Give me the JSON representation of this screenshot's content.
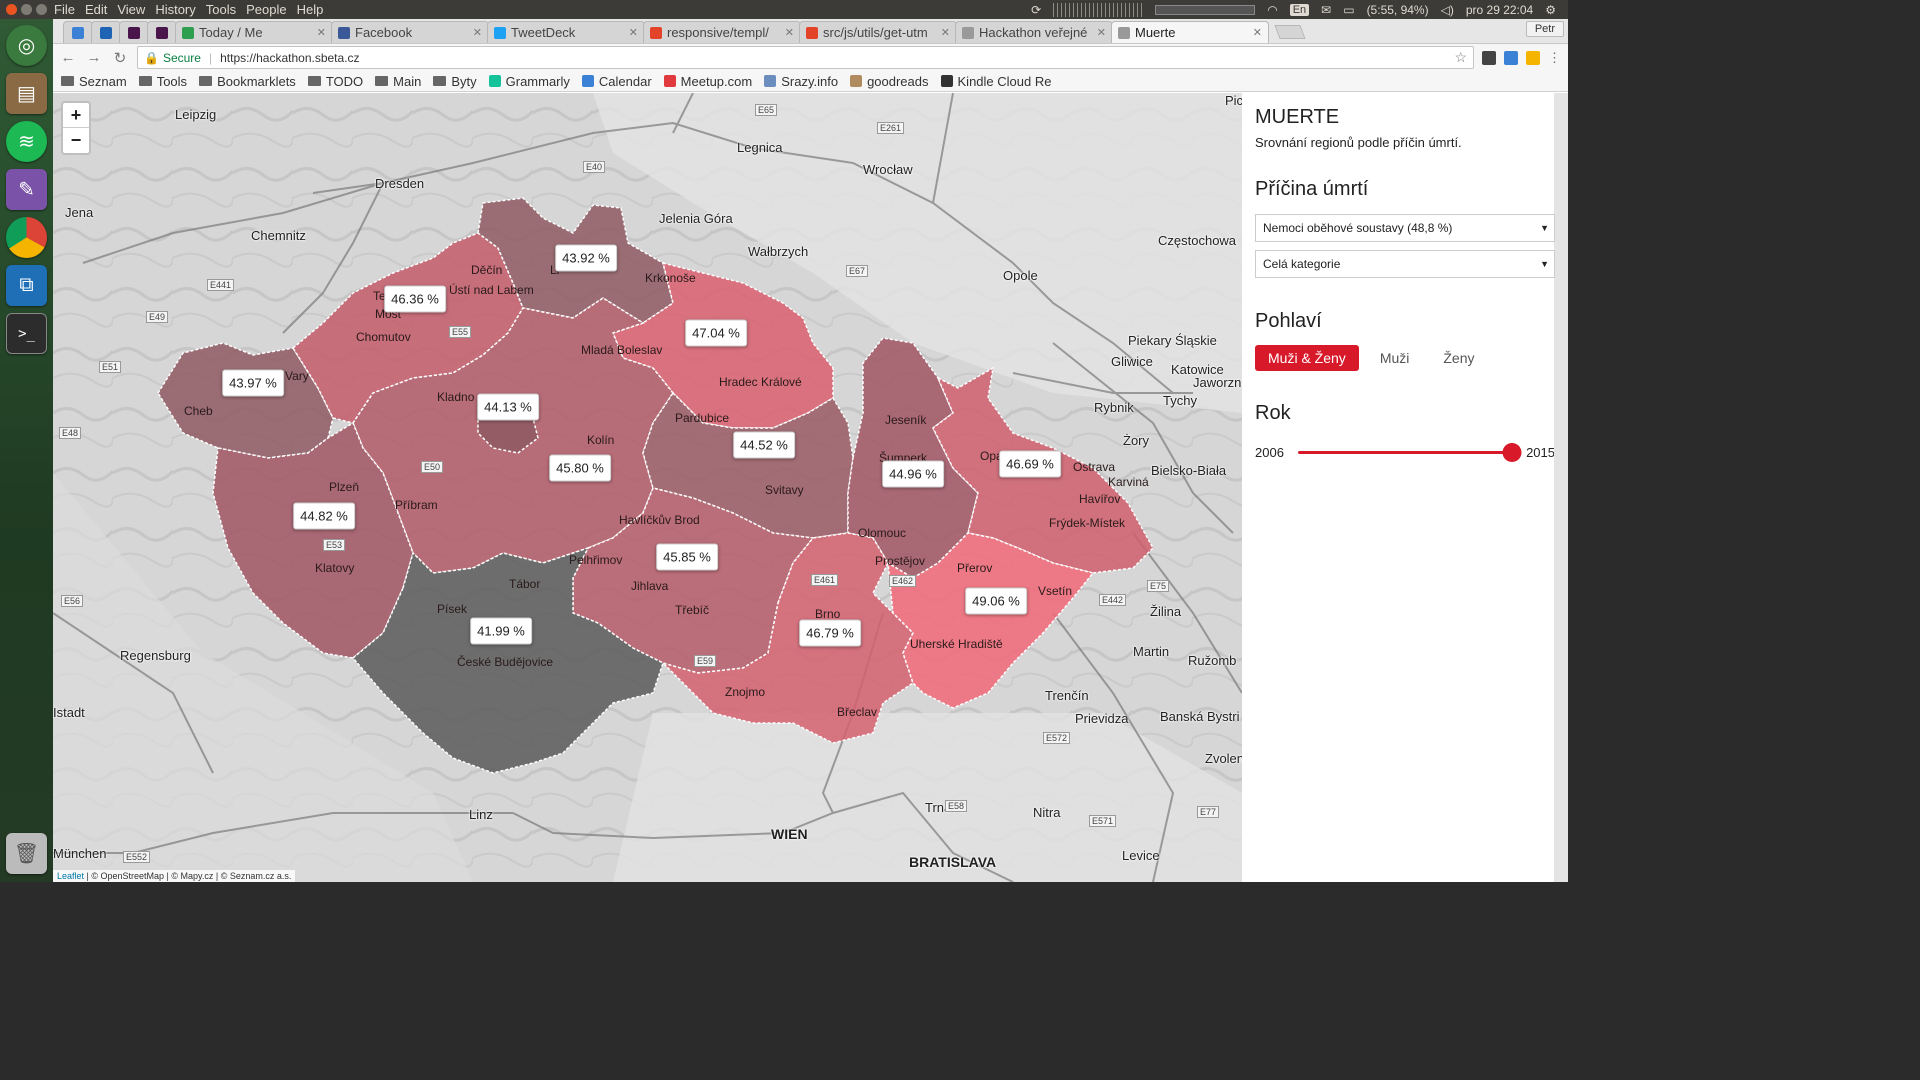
{
  "top_panel": {
    "menu": [
      "File",
      "Edit",
      "View",
      "History",
      "Tools",
      "People",
      "Help"
    ],
    "lang": "En",
    "battery": "(5:55, 94%)",
    "datetime": "pro 29 22:04"
  },
  "launcher": {
    "apps": [
      "ubuntu-icon",
      "files-icon",
      "spotify-icon",
      "pidgin-icon",
      "chrome-icon",
      "vscode-icon",
      "terminal-icon",
      "trash-icon"
    ]
  },
  "browser": {
    "profile": "Petr",
    "tabs": [
      {
        "label": "",
        "kind": "pinned",
        "color": "#3b82d6"
      },
      {
        "label": "",
        "kind": "pinned",
        "color": "#1e63b4"
      },
      {
        "label": "",
        "kind": "pinned",
        "color": "#4a154b"
      },
      {
        "label": "",
        "kind": "pinned",
        "color": "#4a154b"
      },
      {
        "label": "Today / Me",
        "kind": "normal",
        "color": "#2e9e4f"
      },
      {
        "label": "Facebook",
        "kind": "normal",
        "color": "#3b5998"
      },
      {
        "label": "TweetDeck",
        "kind": "normal",
        "color": "#1da1f2"
      },
      {
        "label": "responsive/templ/",
        "kind": "normal",
        "color": "#e24329"
      },
      {
        "label": "src/js/utils/get-utm",
        "kind": "normal",
        "color": "#e24329"
      },
      {
        "label": "Hackathon veřejné",
        "kind": "normal",
        "color": "#999999"
      },
      {
        "label": "Muerte",
        "kind": "normal",
        "color": "#999999",
        "active": true
      }
    ],
    "secure_label": "Secure",
    "url": "https://hackathon.sbeta.cz",
    "bookmarks": [
      {
        "label": "Seznam",
        "type": "folder"
      },
      {
        "label": "Tools",
        "type": "folder"
      },
      {
        "label": "Bookmarklets",
        "type": "folder"
      },
      {
        "label": "TODO",
        "type": "folder"
      },
      {
        "label": "Main",
        "type": "folder"
      },
      {
        "label": "Byty",
        "type": "folder"
      },
      {
        "label": "Grammarly",
        "type": "link",
        "color": "#15c39a"
      },
      {
        "label": "Calendar",
        "type": "link",
        "color": "#3b82d6"
      },
      {
        "label": "Meetup.com",
        "type": "link",
        "color": "#e0393e"
      },
      {
        "label": "Srazy.info",
        "type": "link",
        "color": "#6c8ebf"
      },
      {
        "label": "goodreads",
        "type": "link",
        "color": "#b18b60"
      },
      {
        "label": "Kindle Cloud Re",
        "type": "link",
        "color": "#333333"
      }
    ]
  },
  "map": {
    "zoom_in": "+",
    "zoom_out": "−",
    "attribution": {
      "leaflet": "Leaflet",
      "rest": " | © OpenStreetMap | © Mapy.cz | © Seznam.cz a.s."
    },
    "region_values": [
      {
        "id": "karlovarsky",
        "value": "43.97 %",
        "color": "#8e5a62"
      },
      {
        "id": "ustecky",
        "value": "46.36 %",
        "color": "#c35c6a"
      },
      {
        "id": "liberecky",
        "value": "43.92 %",
        "color": "#8e5a62"
      },
      {
        "id": "kralovehradecky",
        "value": "47.04 %",
        "color": "#d9606f"
      },
      {
        "id": "praha",
        "value": "44.13 %",
        "color": "#8e5a62"
      },
      {
        "id": "stredocesky",
        "value": "45.80 %",
        "color": "#b25a67"
      },
      {
        "id": "plzensky",
        "value": "44.82 %",
        "color": "#a05563"
      },
      {
        "id": "pardubicky",
        "value": "44.52 %",
        "color": "#995a64"
      },
      {
        "id": "olomoucky",
        "value": "44.96 %",
        "color": "#a05563"
      },
      {
        "id": "moravskoslezsky",
        "value": "46.69 %",
        "color": "#cf5f6d"
      },
      {
        "id": "vysocina",
        "value": "45.85 %",
        "color": "#b55c69"
      },
      {
        "id": "jihocesky",
        "value": "41.99 %",
        "color": "#5a5a5a"
      },
      {
        "id": "jihomoravsky",
        "value": "46.79 %",
        "color": "#d4606e"
      },
      {
        "id": "zlinsky",
        "value": "49.06 %",
        "color": "#f26878"
      }
    ],
    "places": [
      "Leipzig",
      "Dresden",
      "Jena",
      "Chemnitz",
      "Legnica",
      "Wrocław",
      "Jelenia Góra",
      "Wałbrzych",
      "Opole",
      "Częstochowa",
      "Piekary Śląskie",
      "Gliwice",
      "Katowice",
      "Jaworzn",
      "Rybnik",
      "Tychy",
      "Żory",
      "Bielsko-Biała",
      "Žilina",
      "Martin",
      "Ružomb",
      "Trenčín",
      "Prievidza",
      "Banská Bystri",
      "Zvolen",
      "Nitra",
      "Trnava",
      "Levice",
      "BRATISLAVA",
      "WIEN",
      "Linz",
      "München",
      "Regensburg",
      "Istadt",
      "Pic"
    ],
    "region_cities": [
      "Děčín",
      "Ústí nad Labem",
      "Teplice",
      "Most",
      "Chomutov",
      "Vary",
      "Cheb",
      "Kladno",
      "Mladá Boleslav",
      "Hradec Králové",
      "Pardubice",
      "Kolín",
      "Plzeň",
      "Příbram",
      "Klatovy",
      "Svitavy",
      "Havlíčkův Brod",
      "Pelhřimov",
      "Tábor",
      "Písek",
      "České Budějovice",
      "Jihlava",
      "Třebíč",
      "Brno",
      "Znojmo",
      "Břeclav",
      "Uherské Hradiště",
      "Vsetín",
      "Olomouc",
      "Prostějov",
      "Přerov",
      "Opava",
      "Ostrava",
      "Havířov",
      "Frýdek-Místek",
      "Karviná",
      "Jeseník",
      "Šumperk",
      "Krkonoše",
      "Li"
    ],
    "roads": [
      "E65",
      "E261",
      "E40",
      "E67",
      "E441",
      "E49",
      "E51",
      "E48",
      "E55",
      "E50",
      "E53",
      "E56",
      "E461",
      "E462",
      "E442",
      "E75",
      "E59",
      "E552",
      "E58",
      "E571",
      "E77",
      "E572"
    ]
  },
  "sidebar": {
    "title": "MUERTE",
    "subtitle": "Srovnání regionů podle příčin úmrtí.",
    "cause_heading": "Příčina úmrtí",
    "cause_select": "Nemoci oběhové soustavy (48,8 %)",
    "category_select": "Celá kategorie",
    "gender_heading": "Pohlaví",
    "gender_options": [
      "Muži & Ženy",
      "Muži",
      "Ženy"
    ],
    "gender_selected": 0,
    "year_heading": "Rok",
    "year_min": "2006",
    "year_max": "2015",
    "year_value": 2015
  },
  "colors": {
    "accent": "#d7192a",
    "region_low": "#5a5a5a",
    "region_high": "#f26878"
  }
}
